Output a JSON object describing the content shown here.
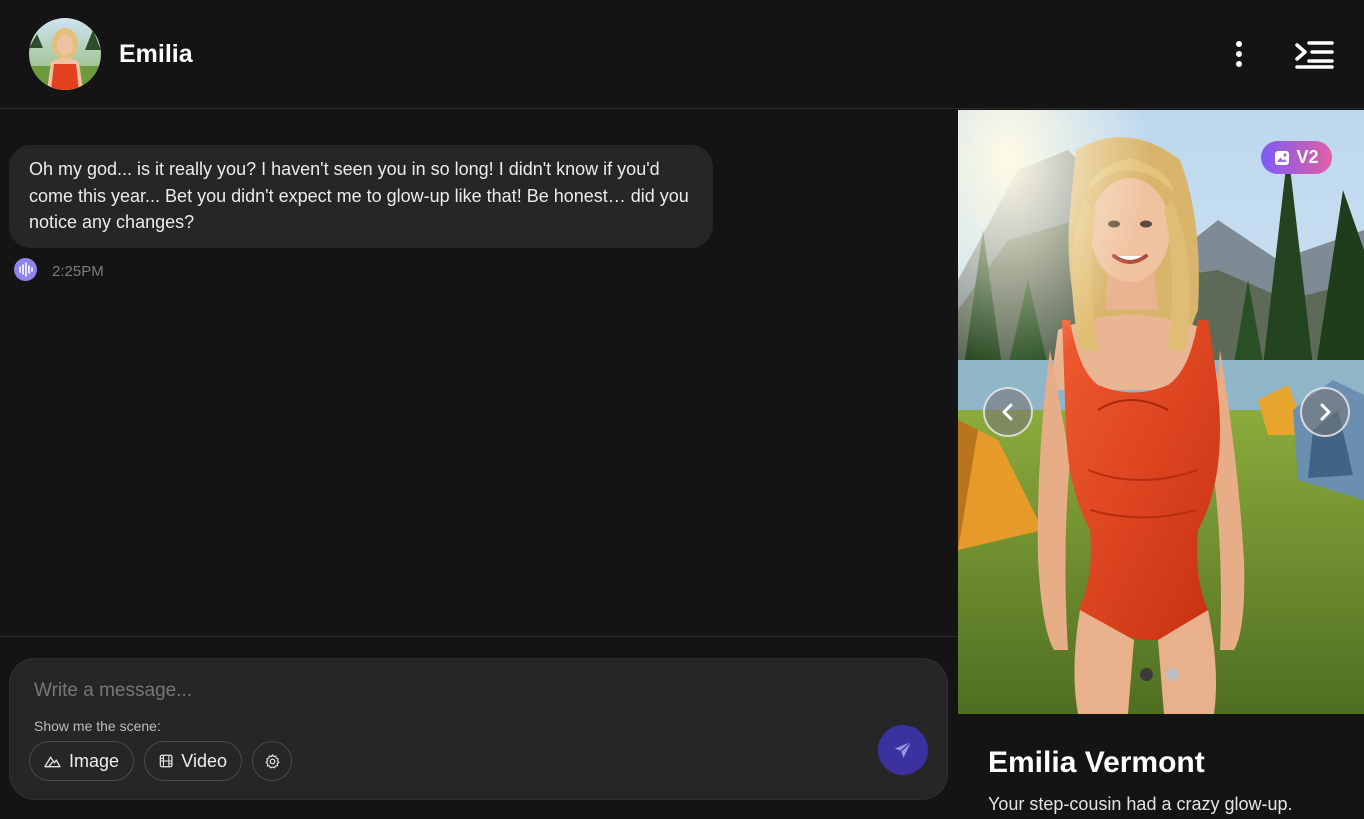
{
  "header": {
    "name": "Emilia"
  },
  "chat": {
    "messages": [
      {
        "text": "Oh my god... is it really you? I haven't seen you in so long! I didn't know if you'd come this year... Bet you didn't expect me to glow-up like that! Be honest… did you notice any changes?",
        "time": "2:25PM"
      }
    ]
  },
  "composer": {
    "placeholder": "Write a message...",
    "scene_label": "Show me the scene:",
    "image_label": "Image",
    "video_label": "Video"
  },
  "panel": {
    "badge": "V2",
    "character_name": "Emilia Vermont",
    "character_description": "Your step-cousin had a crazy glow-up.",
    "slides_total": 2,
    "active_slide": 1
  },
  "colors": {
    "background": "#141414",
    "bubble": "#262626",
    "accent": "#8d84f2",
    "send_button": "#3b32a0",
    "badge_gradient_start": "#7d5cf3",
    "badge_gradient_end": "#e05fa6",
    "swimsuit": "#e2401f"
  },
  "icons": {
    "more": "more-vertical-icon",
    "menu": "sidebar-toggle-icon",
    "audio": "audio-wave-icon",
    "image": "image-mountain-icon",
    "video": "film-icon",
    "settings": "gear-icon",
    "send": "send-icon",
    "prev": "chevron-left-icon",
    "next": "chevron-right-icon"
  }
}
